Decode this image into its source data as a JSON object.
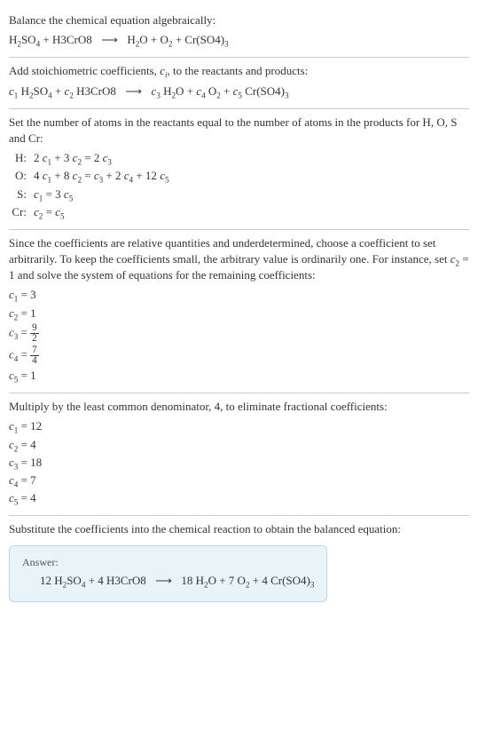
{
  "section1": {
    "title": "Balance the chemical equation algebraically:"
  },
  "section2": {
    "title": "Add stoichiometric coefficients, ",
    "title_var": "c",
    "title_sub": "i",
    "title_end": ", to the reactants and products:"
  },
  "section3": {
    "title": "Set the number of atoms in the reactants equal to the number of atoms in the products for H, O, S and Cr:",
    "atoms": [
      {
        "label": "H:",
        "eq_lhs_a": "2",
        "eq_lhs_b": "3",
        "eq_rhs": "2",
        "sub1": "1",
        "sub2": "2",
        "sub3": "3"
      },
      {
        "label": "O:",
        "eq_lhs_a": "4",
        "eq_lhs_b": "8",
        "sub1": "1",
        "sub2": "2"
      },
      {
        "label": "S:"
      },
      {
        "label": "Cr:"
      }
    ]
  },
  "section4": {
    "text_a": "Since the coefficients are relative quantities and underdetermined, choose a coefficient to set arbitrarily. To keep the coefficients small, the arbitrary value is ordinarily one. For instance, set ",
    "text_b": " = 1 and solve the system of equations for the remaining coefficients:",
    "c1": "3",
    "c2": "1",
    "c3_num": "9",
    "c3_den": "2",
    "c4_num": "7",
    "c4_den": "4",
    "c5": "1"
  },
  "section5": {
    "text": "Multiply by the least common denominator, 4, to eliminate fractional coefficients:",
    "c1": "12",
    "c2": "4",
    "c3": "18",
    "c4": "7",
    "c5": "4"
  },
  "section6": {
    "text": "Substitute the coefficients into the chemical reaction to obtain the balanced equation:"
  },
  "answer": {
    "label": "Answer:",
    "coef1": "12",
    "coef2": "4",
    "coef3": "18",
    "coef4": "7",
    "coef5": "4"
  },
  "chart_data": {
    "type": "table",
    "title": "Chemical equation balancing",
    "reactants": [
      "H2SO4",
      "H3CrO8"
    ],
    "products": [
      "H2O",
      "O2",
      "Cr(SO4)3"
    ],
    "elements": [
      "H",
      "O",
      "S",
      "Cr"
    ],
    "atom_equations": {
      "H": "2c1 + 3c2 = 2c3",
      "O": "4c1 + 8c2 = c3 + 2c4 + 12c5",
      "S": "c1 = 3c5",
      "Cr": "c2 = c5"
    },
    "initial_solution": {
      "c1": 3,
      "c2": 1,
      "c3": 4.5,
      "c4": 1.75,
      "c5": 1
    },
    "lcd": 4,
    "final_coefficients": {
      "c1": 12,
      "c2": 4,
      "c3": 18,
      "c4": 7,
      "c5": 4
    },
    "balanced_equation": "12 H2SO4 + 4 H3CrO8 -> 18 H2O + 7 O2 + 4 Cr(SO4)3"
  }
}
